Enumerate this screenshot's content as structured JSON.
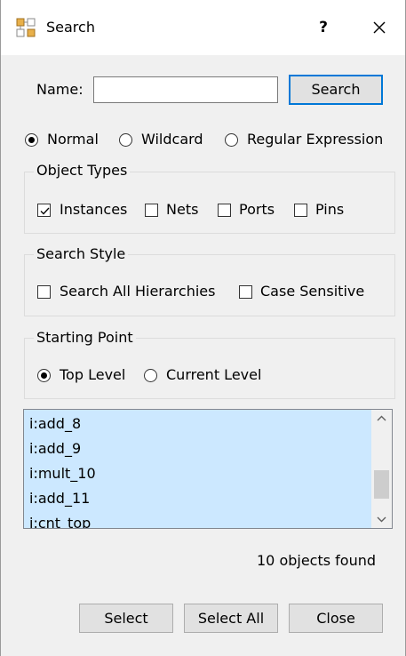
{
  "window": {
    "title": "Search",
    "help": "?"
  },
  "name_row": {
    "label": "Name:",
    "value": "",
    "search_button": "Search"
  },
  "match_mode": {
    "options": [
      "Normal",
      "Wildcard",
      "Regular Expression"
    ],
    "selected": "Normal"
  },
  "object_types": {
    "title": "Object Types",
    "options": [
      {
        "label": "Instances",
        "checked": true
      },
      {
        "label": "Nets",
        "checked": false
      },
      {
        "label": "Ports",
        "checked": false
      },
      {
        "label": "Pins",
        "checked": false
      }
    ]
  },
  "search_style": {
    "title": "Search Style",
    "options": [
      {
        "label": "Search All Hierarchies",
        "checked": false
      },
      {
        "label": "Case Sensitive",
        "checked": false
      }
    ]
  },
  "starting_point": {
    "title": "Starting Point",
    "options": [
      "Top Level",
      "Current Level"
    ],
    "selected": "Top Level"
  },
  "results": {
    "items": [
      "i:add_8",
      "i:add_9",
      "i:mult_10",
      "i:add_11",
      "i:cnt_top"
    ],
    "status": "10 objects found"
  },
  "buttons": {
    "select": "Select",
    "select_all": "Select All",
    "close": "Close"
  }
}
